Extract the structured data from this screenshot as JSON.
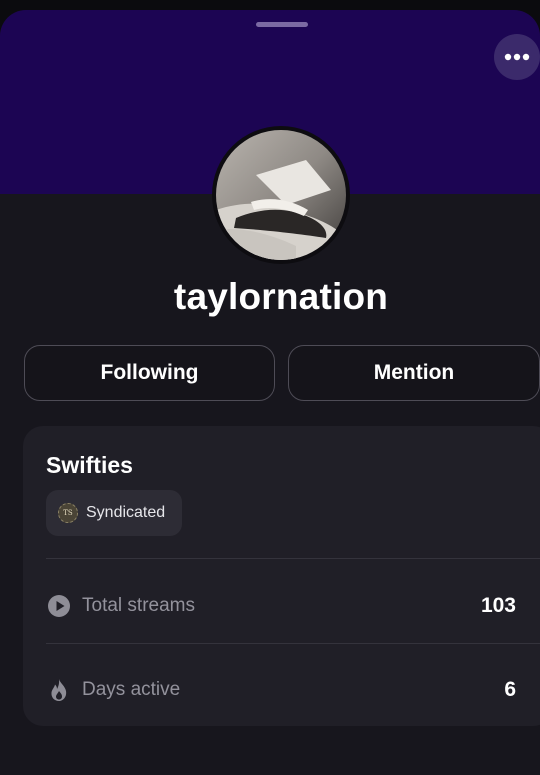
{
  "profile": {
    "username": "taylornation"
  },
  "actions": {
    "following_label": "Following",
    "mention_label": "Mention"
  },
  "community": {
    "title": "Swifties",
    "badge": {
      "icon": "ts-seal-icon",
      "icon_text": "TS",
      "label": "Syndicated"
    },
    "stats": [
      {
        "icon": "play-circle-icon",
        "label": "Total streams",
        "value": "103"
      },
      {
        "icon": "flame-icon",
        "label": "Days active",
        "value": "6"
      }
    ]
  },
  "colors": {
    "banner": "#1c0553",
    "background": "#17161d",
    "card": "#201f27",
    "muted_text": "#93929c"
  }
}
